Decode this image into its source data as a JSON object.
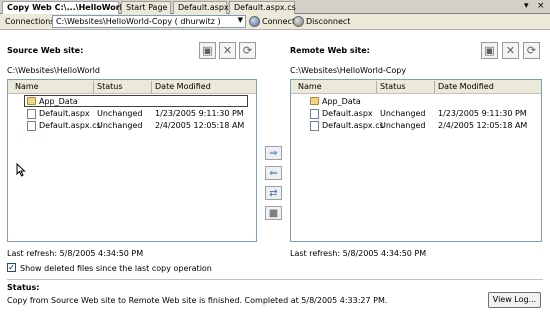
{
  "tabs": [
    {
      "label": "Copy Web C:\\...\\HelloWorld\\",
      "active": true
    },
    {
      "label": "Start Page",
      "active": false
    },
    {
      "label": "Default.aspx",
      "active": false
    },
    {
      "label": "Default.aspx.cs",
      "active": false
    }
  ],
  "tab_controls": {
    "dropdown": "▾",
    "close": "×"
  },
  "connections": {
    "label": "Connections:",
    "value": "C:\\Websites\\HelloWorld-Copy ( dhurwitz )",
    "connect": "Connect",
    "disconnect": "Disconnect"
  },
  "source": {
    "title": "Source Web site:",
    "path": "C:\\Websites\\HelloWorld",
    "columns": [
      "Name",
      "Status",
      "Date Modified"
    ],
    "rows": [
      {
        "name": "App_Data",
        "type": "folder",
        "status": "",
        "date": ""
      },
      {
        "name": "Default.aspx",
        "type": "file",
        "status": "Unchanged",
        "date": "1/23/2005 9:11:30 PM"
      },
      {
        "name": "Default.aspx.cs",
        "type": "file",
        "status": "Unchanged",
        "date": "2/4/2005 12:05:18 AM"
      }
    ],
    "last_refresh": "Last refresh: 5/8/2005 4:34:50 PM"
  },
  "remote": {
    "title": "Remote Web site:",
    "path": "C:\\Websites\\HelloWorld-Copy",
    "columns": [
      "Name",
      "Status",
      "Date Modified"
    ],
    "rows": [
      {
        "name": "App_Data",
        "type": "folder",
        "status": "",
        "date": ""
      },
      {
        "name": "Default.aspx",
        "type": "file",
        "status": "Unchanged",
        "date": "1/23/2005 9:11:30 PM"
      },
      {
        "name": "Default.aspx.cs",
        "type": "file",
        "status": "Unchanged",
        "date": "2/4/2005 12:05:18 AM"
      }
    ],
    "last_refresh": "Last refresh: 5/8/2005 4:34:50 PM"
  },
  "options": {
    "show_deleted_label": "Show deleted files since the last copy operation",
    "show_deleted_checked": true,
    "check_glyph": "✓"
  },
  "status": {
    "title": "Status:",
    "text": "Copy from Source Web site to Remote Web site is finished. Completed at 5/8/2005 4:33:27 PM.",
    "view_log": "View Log..."
  },
  "icons": {
    "copy_right": "⇒",
    "copy_left": "⇐",
    "sync": "⇄",
    "stop": "■",
    "new_folder": "▣",
    "delete": "✕",
    "refresh": "⟳"
  }
}
